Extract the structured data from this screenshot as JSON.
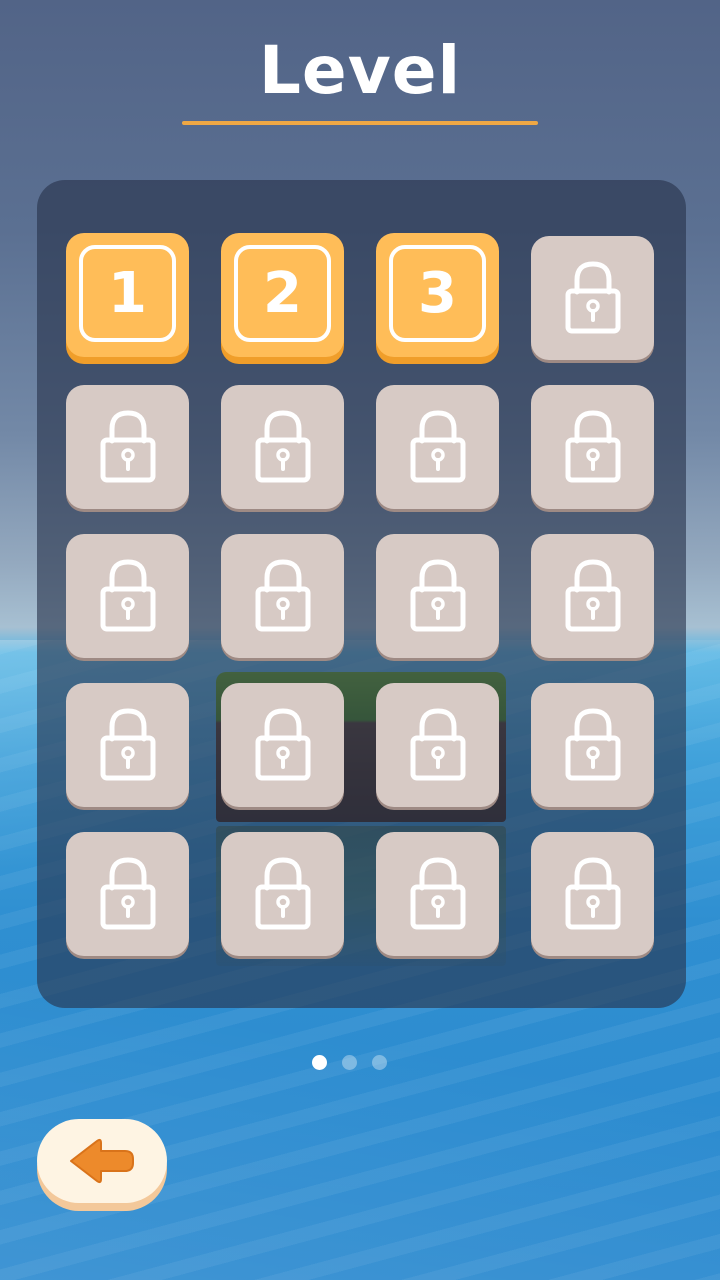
{
  "screen": {
    "title": "Level"
  },
  "levels": [
    {
      "label": "1",
      "state": "unlocked"
    },
    {
      "label": "2",
      "state": "unlocked"
    },
    {
      "label": "3",
      "state": "unlocked"
    },
    {
      "label": "",
      "state": "locked"
    },
    {
      "label": "",
      "state": "locked"
    },
    {
      "label": "",
      "state": "locked"
    },
    {
      "label": "",
      "state": "locked"
    },
    {
      "label": "",
      "state": "locked"
    },
    {
      "label": "",
      "state": "locked"
    },
    {
      "label": "",
      "state": "locked"
    },
    {
      "label": "",
      "state": "locked"
    },
    {
      "label": "",
      "state": "locked"
    },
    {
      "label": "",
      "state": "locked"
    },
    {
      "label": "",
      "state": "locked"
    },
    {
      "label": "",
      "state": "locked"
    },
    {
      "label": "",
      "state": "locked"
    },
    {
      "label": "",
      "state": "locked"
    },
    {
      "label": "",
      "state": "locked"
    },
    {
      "label": "",
      "state": "locked"
    },
    {
      "label": "",
      "state": "locked"
    }
  ],
  "pagination": {
    "page_count": 3,
    "current_page": 1
  },
  "icons": {
    "locked": "lock-icon",
    "back": "arrow-left-icon"
  },
  "colors": {
    "unlocked_fill": "#ffbd58",
    "locked_fill": "#d7cac5",
    "accent": "#f0a844",
    "back_arrow": "#ed8a2b"
  }
}
